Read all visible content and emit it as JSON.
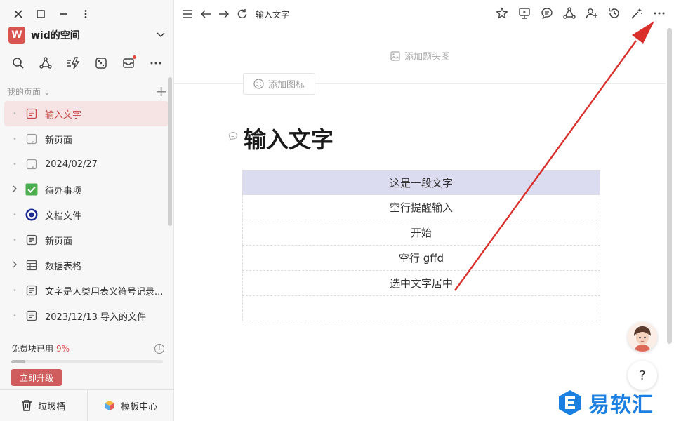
{
  "workspace": {
    "logo_letter": "W",
    "name": "wid的空间"
  },
  "sidebar": {
    "section_label": "我的页面",
    "items": [
      {
        "label": "输入文字",
        "icon": "doc-icon",
        "active": true
      },
      {
        "label": "新页面",
        "icon": "blank-page-icon"
      },
      {
        "label": "2024/02/27",
        "icon": "blank-page-icon"
      },
      {
        "label": "待办事项",
        "icon": "checkbox-icon",
        "expandable": true
      },
      {
        "label": "文档文件",
        "icon": "target-icon"
      },
      {
        "label": "新页面",
        "icon": "doc-icon"
      },
      {
        "label": "数据表格",
        "icon": "table-icon",
        "expandable": true
      },
      {
        "label": "文字是人类用表义符号记录...",
        "icon": "doc-icon"
      },
      {
        "label": "2023/12/13 导入的文件",
        "icon": "doc-icon"
      }
    ],
    "quota_label": "免费块已用",
    "quota_percent": "9%",
    "quota_fraction": 0.09,
    "upgrade_label": "立即升级",
    "trash_label": "垃圾桶",
    "templates_label": "模板中心"
  },
  "topbar": {
    "title": "输入文字"
  },
  "doc": {
    "add_cover": "添加题头图",
    "add_icon": "添加图标",
    "title": "输入文字",
    "rows": [
      "这是一段文字",
      "空行提醒输入",
      "开始",
      "空行 gffd",
      "选中文字居中",
      ""
    ]
  },
  "help_label": "?",
  "watermark": "易软汇",
  "colors": {
    "accent": "#d9534f",
    "highlight_row": "#dcdcf0",
    "arrow": "#d9302c",
    "watermark": "#1a7fe0"
  }
}
